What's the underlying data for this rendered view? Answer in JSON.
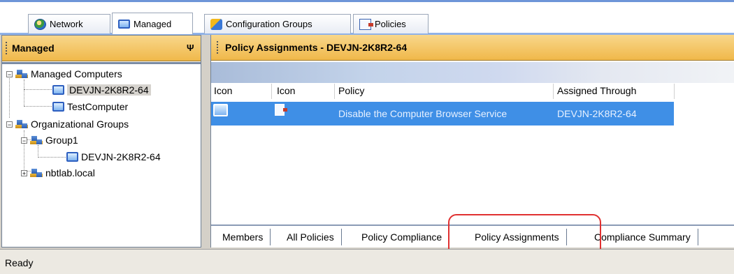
{
  "top_tabs": [
    {
      "label": "Network",
      "icon": "globe-icon"
    },
    {
      "label": "Managed",
      "icon": "monitor-icon"
    },
    {
      "label": "Configuration Groups",
      "icon": "config-groups-icon"
    },
    {
      "label": "Policies",
      "icon": "policy-icon"
    }
  ],
  "left_panel": {
    "title": "Managed",
    "pin": "Ψ",
    "tree": [
      {
        "label": "Managed Computers",
        "icon": "computer-group-icon",
        "expand": "−"
      },
      {
        "label": "DEVJN-2K8R2-64",
        "icon": "computer-icon"
      },
      {
        "label": "TestComputer",
        "icon": "computer-icon"
      },
      {
        "label": "Organizational Groups",
        "icon": "computer-group-icon",
        "expand": "−"
      },
      {
        "label": "Group1",
        "icon": "computer-group-icon",
        "expand": "−"
      },
      {
        "label": "DEVJN-2K8R2-64",
        "icon": "computer-icon"
      },
      {
        "label": "nbtlab.local",
        "icon": "computer-group-icon",
        "expand": "+"
      }
    ]
  },
  "right_panel": {
    "title": "Policy Assignments - DEVJN-2K8R2-64",
    "columns": [
      "Icon",
      "Icon",
      "Policy",
      "Assigned Through"
    ],
    "rows": [
      {
        "policy": "Disable the Computer Browser Service",
        "assigned_through": "DEVJN-2K8R2-64"
      }
    ],
    "bottom_tabs": [
      "Members",
      "All Policies",
      "Policy Compliance",
      "Policy Assignments",
      "Compliance Summary"
    ]
  },
  "status": "Ready",
  "colors": {
    "highlight": "#e03030",
    "selection": "#3f8fe6",
    "header": "#f0b84a"
  }
}
